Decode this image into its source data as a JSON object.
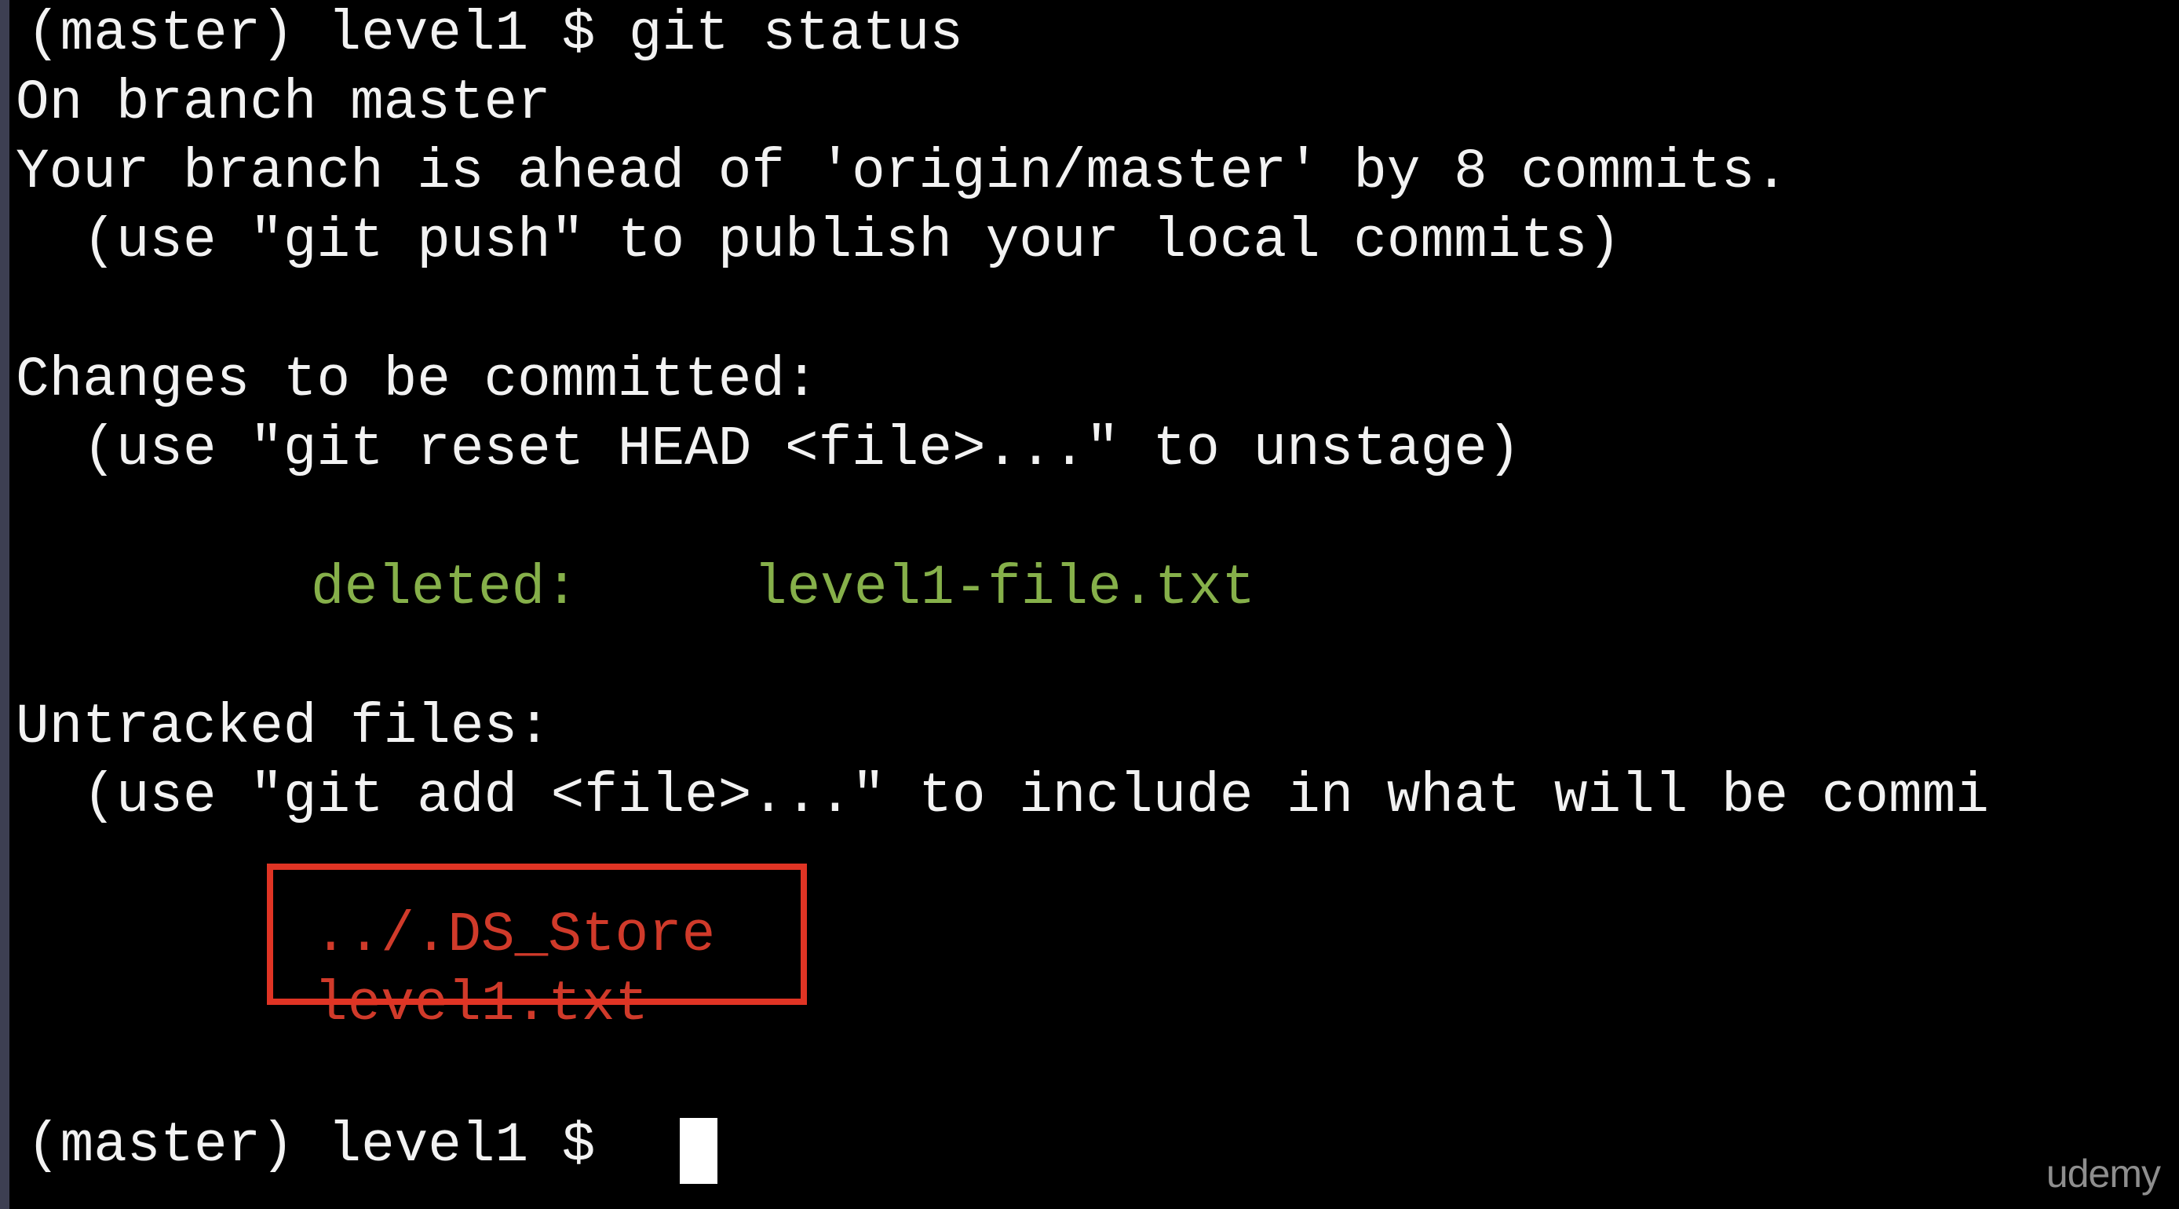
{
  "terminal": {
    "lines": [
      {
        "text": "(master) level1 $ git status"
      },
      {
        "text": "On branch master"
      },
      {
        "text": "Your branch is ahead of 'origin/master' by 8 commits."
      },
      {
        "text": "  (use \"git push\" to publish your local commits)"
      },
      {
        "text": "Changes to be committed:"
      },
      {
        "text": "  (use \"git reset HEAD <file>...\" to unstage)"
      },
      {
        "label": "deleted:",
        "file": "level1-file.txt"
      },
      {
        "text": "Untracked files:"
      },
      {
        "text": "  (use \"git add <file>...\" to include in what will be commi"
      },
      {
        "text": "../.DS_Store"
      },
      {
        "text": "level1.txt"
      },
      {
        "text": "(master) level1 $ "
      }
    ]
  },
  "watermark": "udemy",
  "colors": {
    "background": "#000000",
    "text": "#f2f2f2",
    "staged": "#86b04a",
    "untracked": "#d03a2a",
    "highlight_box": "#e03424"
  }
}
